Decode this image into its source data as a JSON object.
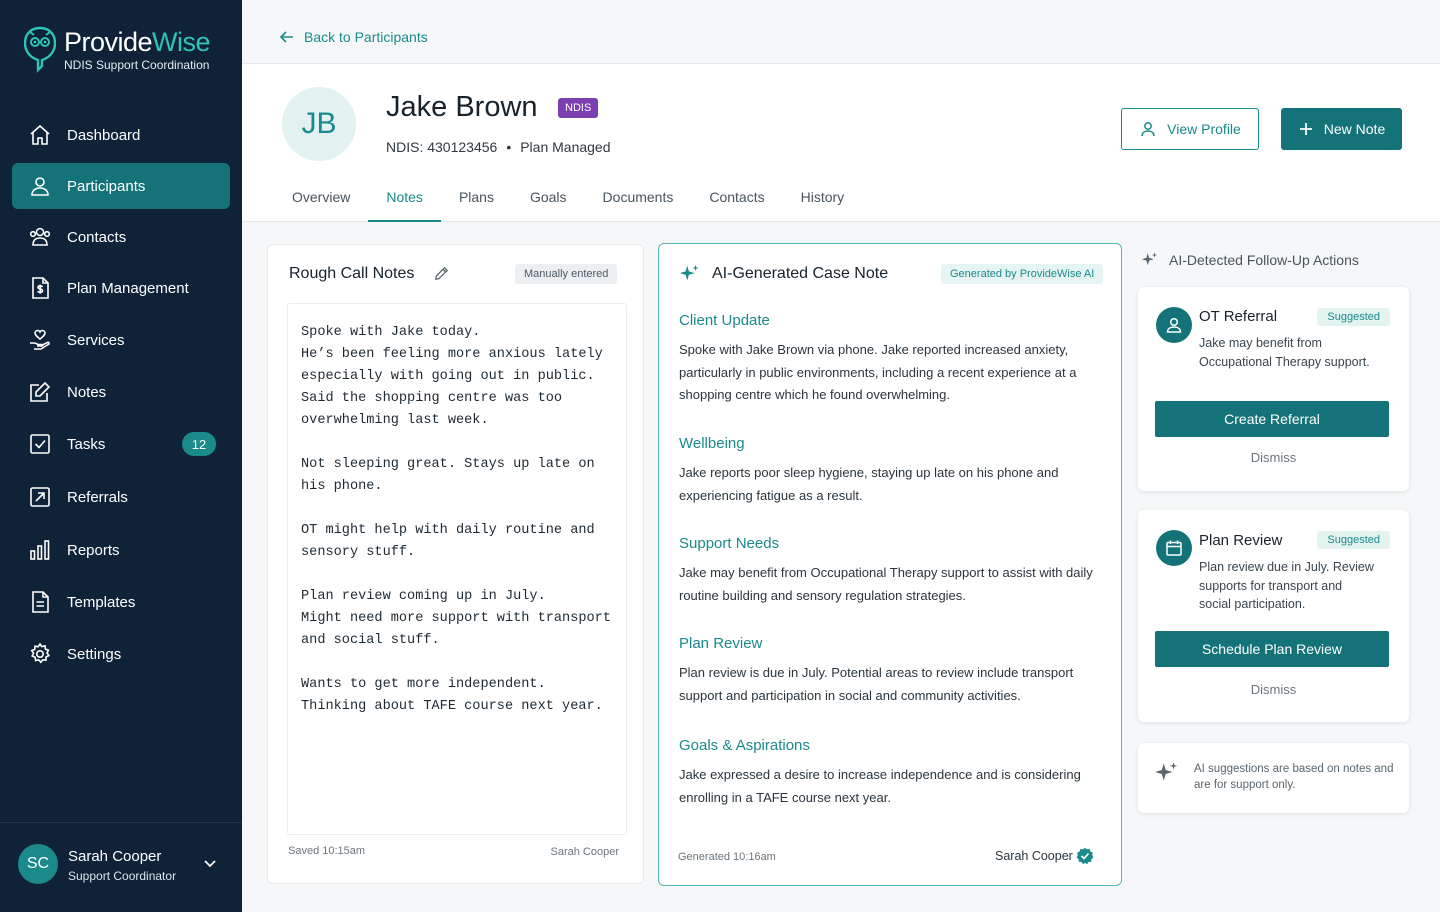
{
  "brand": {
    "name_part1": "Provide",
    "name_part2": "Wise",
    "subtitle": "NDIS Support Coordination"
  },
  "sidebar": {
    "items": [
      {
        "label": "Dashboard",
        "icon": "home-icon"
      },
      {
        "label": "Participants",
        "icon": "user-icon",
        "active": true
      },
      {
        "label": "Contacts",
        "icon": "contacts-icon"
      },
      {
        "label": "Plan Management",
        "icon": "dollar-document-icon"
      },
      {
        "label": "Services",
        "icon": "hand-heart-icon"
      },
      {
        "label": "Notes",
        "icon": "edit-note-icon"
      },
      {
        "label": "Tasks",
        "icon": "checkbox-icon",
        "badge": "12"
      },
      {
        "label": "Referrals",
        "icon": "referral-arrow-icon"
      },
      {
        "label": "Reports",
        "icon": "bar-chart-icon"
      },
      {
        "label": "Templates",
        "icon": "document-icon"
      },
      {
        "label": "Settings",
        "icon": "gear-icon"
      }
    ],
    "user": {
      "initials": "SC",
      "name": "Sarah Cooper",
      "role": "Support Coordinator"
    }
  },
  "header": {
    "back_label": "Back to Participants"
  },
  "participant": {
    "initials": "JB",
    "name": "Jake Brown",
    "badge": "NDIS",
    "ndis_number": "NDIS: 430123456",
    "dot": "•",
    "plan_type": "Plan Managed",
    "view_profile_label": "View Profile",
    "new_note_label": "New Note"
  },
  "tabs": [
    "Overview",
    "Notes",
    "Plans",
    "Goals",
    "Documents",
    "Contacts",
    "History"
  ],
  "active_tab": "Notes",
  "rough_notes": {
    "title": "Rough Call Notes",
    "chip": "Manually entered",
    "text": "Spoke with Jake today.\nHe’s been feeling more anxious lately\nespecially with going out in public.\nSaid the shopping centre was too\noverwhelming last week.\n\nNot sleeping great. Stays up late on\nhis phone.\n\nOT might help with daily routine and\nsensory stuff.\n\nPlan review coming up in July.\nMight need more support with transport\nand social stuff.\n\nWants to get more independent.\nThinking about TAFE course next year.",
    "saved": "Saved 10:15am",
    "author": "Sarah Cooper"
  },
  "ai_note": {
    "title": "AI-Generated Case Note",
    "chip": "Generated by ProvideWise AI",
    "sections": [
      {
        "heading": "Client Update",
        "body": "Spoke with Jake Brown via phone. Jake reported increased anxiety, particularly in public environments, including a recent experience at a shopping centre which he found overwhelming."
      },
      {
        "heading": "Wellbeing",
        "body": "Jake reports poor sleep hygiene, staying up late on his phone and experiencing fatigue as a result."
      },
      {
        "heading": "Support Needs",
        "body": "Jake may benefit from Occupational Therapy support to assist with daily routine building and sensory regulation strategies."
      },
      {
        "heading": "Plan Review",
        "body": "Plan review is due in July. Potential areas to review include transport support and participation in social and community activities."
      },
      {
        "heading": "Goals & Aspirations",
        "body": "Jake expressed a desire to increase independence and is considering enrolling in a TAFE course next year."
      }
    ],
    "generated": "Generated 10:16am",
    "author": "Sarah Cooper"
  },
  "followups": {
    "title": "AI-Detected Follow-Up Actions",
    "cards": [
      {
        "title": "OT Referral",
        "chip": "Suggested",
        "description": "Jake may benefit from Occupational Therapy support.",
        "button": "Create Referral",
        "dismiss": "Dismiss",
        "icon": "user-icon"
      },
      {
        "title": "Plan Review",
        "chip": "Suggested",
        "description": "Plan review due in July. Review supports for transport and social participation.",
        "button": "Schedule Plan Review",
        "dismiss": "Dismiss",
        "icon": "calendar-icon"
      }
    ],
    "notice": "AI suggestions are based on notes and are for support only."
  },
  "colors": {
    "sidebar": "#0f2238",
    "accent": "#147378",
    "accent_text": "#1a8a8c",
    "brand_teal": "#2ec4b6",
    "ndis_badge": "#7b3fb2"
  }
}
